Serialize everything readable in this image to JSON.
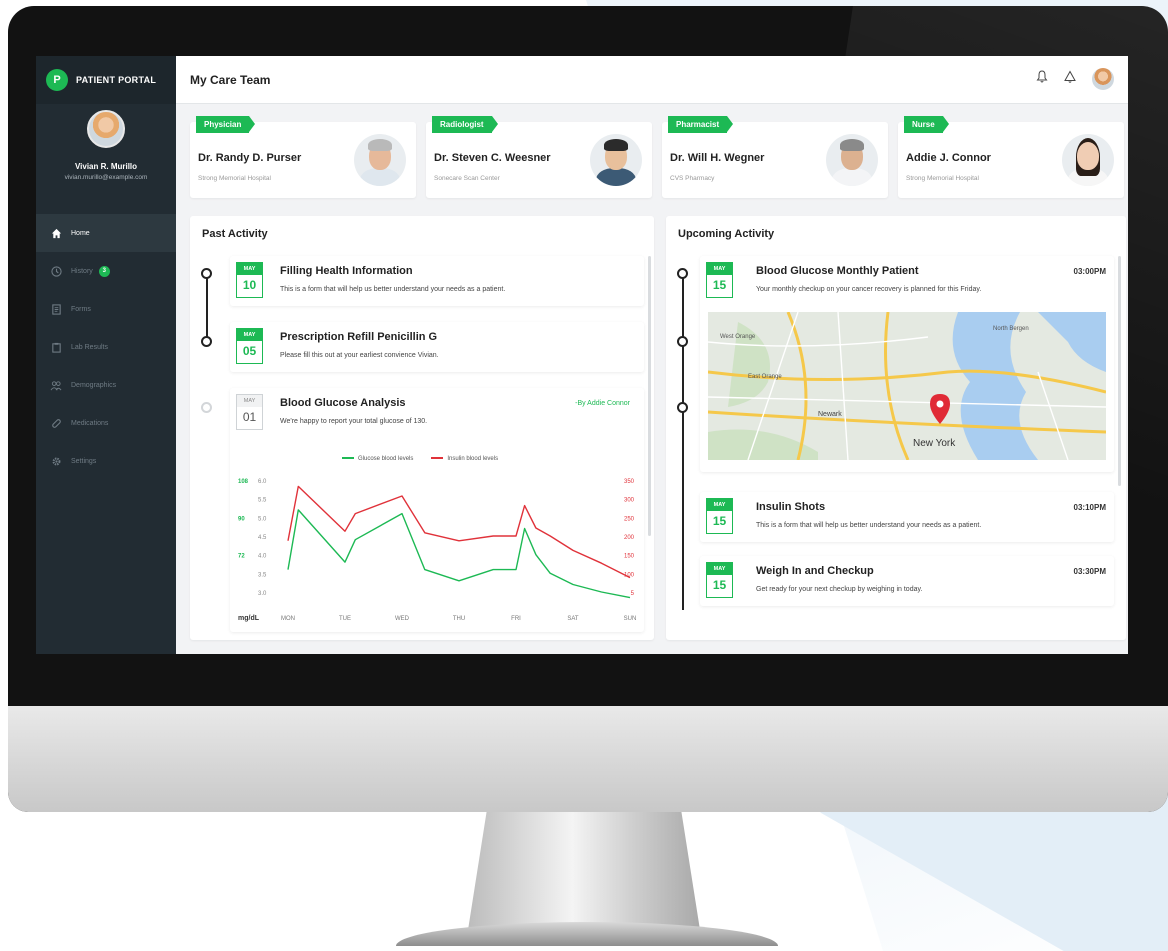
{
  "app": {
    "brand_letter": "P",
    "brand_name": "PATIENT PORTAL",
    "page_title": "My Care Team"
  },
  "user": {
    "name": "Vivian R. Murillo",
    "email": "vivian.murillo@example.com"
  },
  "sidebar": {
    "items": [
      {
        "label": "Home",
        "icon": "home-icon",
        "active": true
      },
      {
        "label": "History",
        "icon": "clock-icon",
        "badge": "3"
      },
      {
        "label": "Forms",
        "icon": "form-icon"
      },
      {
        "label": "Lab Results",
        "icon": "lab-icon"
      },
      {
        "label": "Demographics",
        "icon": "people-icon"
      },
      {
        "label": "Medications",
        "icon": "pill-icon"
      },
      {
        "label": "Settings",
        "icon": "gear-icon"
      }
    ]
  },
  "care_team": [
    {
      "role": "Physician",
      "name": "Dr. Randy D. Purser",
      "place": "Strong Memorial Hospital"
    },
    {
      "role": "Radiologist",
      "name": "Dr. Steven C. Weesner",
      "place": "Sonecare Scan Center"
    },
    {
      "role": "Pharmacist",
      "name": "Dr. Will H. Wegner",
      "place": "CVS Pharmacy"
    },
    {
      "role": "Nurse",
      "name": "Addie J. Connor",
      "place": "Strong Memorial Hospital"
    }
  ],
  "past_activity": {
    "title": "Past Activity",
    "items": [
      {
        "month": "MAY",
        "day": "10",
        "title": "Filling Health Information",
        "desc": "This is a form that will help us better understand your needs as a patient."
      },
      {
        "month": "MAY",
        "day": "05",
        "title": "Prescription Refill Penicillin G",
        "desc": "Please fill this out at your earliest convience Vivian."
      },
      {
        "month": "MAY",
        "day": "01",
        "title": "Blood Glucose Analysis",
        "desc": "We're happy to report your total glucose of 130.",
        "by": "-By Addie Connor"
      }
    ]
  },
  "upcoming_activity": {
    "title": "Upcoming Activity",
    "items": [
      {
        "month": "MAY",
        "day": "15",
        "title": "Blood Glucose Monthly Patient",
        "time": "03:00PM",
        "desc": "Your monthly checkup on your cancer recovery is planned for this Friday."
      },
      {
        "month": "MAY",
        "day": "15",
        "title": "Insulin Shots",
        "time": "03:10PM",
        "desc": "This is a form that will help us better understand your needs as a patient."
      },
      {
        "month": "MAY",
        "day": "15",
        "title": "Weigh In and Checkup",
        "time": "03:30PM",
        "desc": "Get ready for your next checkup by weighing in today."
      }
    ],
    "map_labels": {
      "city": "New York",
      "west_orange": "West Orange",
      "east_orange": "East Orange",
      "newark": "Newark",
      "north_bergen": "North Bergen"
    }
  },
  "chart_data": {
    "type": "line",
    "categories": [
      "MON",
      "TUE",
      "WED",
      "THU",
      "FRI",
      "SAT",
      "SUN"
    ],
    "x_positions": [
      0,
      0.18,
      1,
      1.18,
      2,
      2.4,
      3,
      3.6,
      4,
      4.15,
      4.35,
      4.6,
      5,
      5.5,
      6
    ],
    "series": [
      {
        "name": "Glucose blood levels",
        "color": "#1db954",
        "axis": "left",
        "values": [
          3.6,
          5.2,
          3.8,
          4.4,
          5.1,
          3.6,
          3.3,
          3.6,
          3.6,
          4.7,
          4.0,
          3.5,
          3.2,
          3.0,
          2.85
        ]
      },
      {
        "name": "Insulin blood levels",
        "color": "#e0323a",
        "axis": "right",
        "values": [
          160,
          330,
          190,
          245,
          300,
          185,
          160,
          175,
          175,
          270,
          200,
          175,
          130,
          90,
          45
        ]
      }
    ],
    "left_ticks": [
      "6.0",
      "5.5",
      "5.0",
      "4.5",
      "4.0",
      "3.5",
      "3.0"
    ],
    "left_outer_ticks": [
      "108",
      "90",
      "72"
    ],
    "left_ylim": [
      3.0,
      6.0
    ],
    "right_ticks": [
      "350",
      "300",
      "250",
      "200",
      "150",
      "100",
      "5"
    ],
    "right_ylim": [
      0,
      350
    ],
    "unit_label": "mg/dL",
    "legend": "top"
  }
}
